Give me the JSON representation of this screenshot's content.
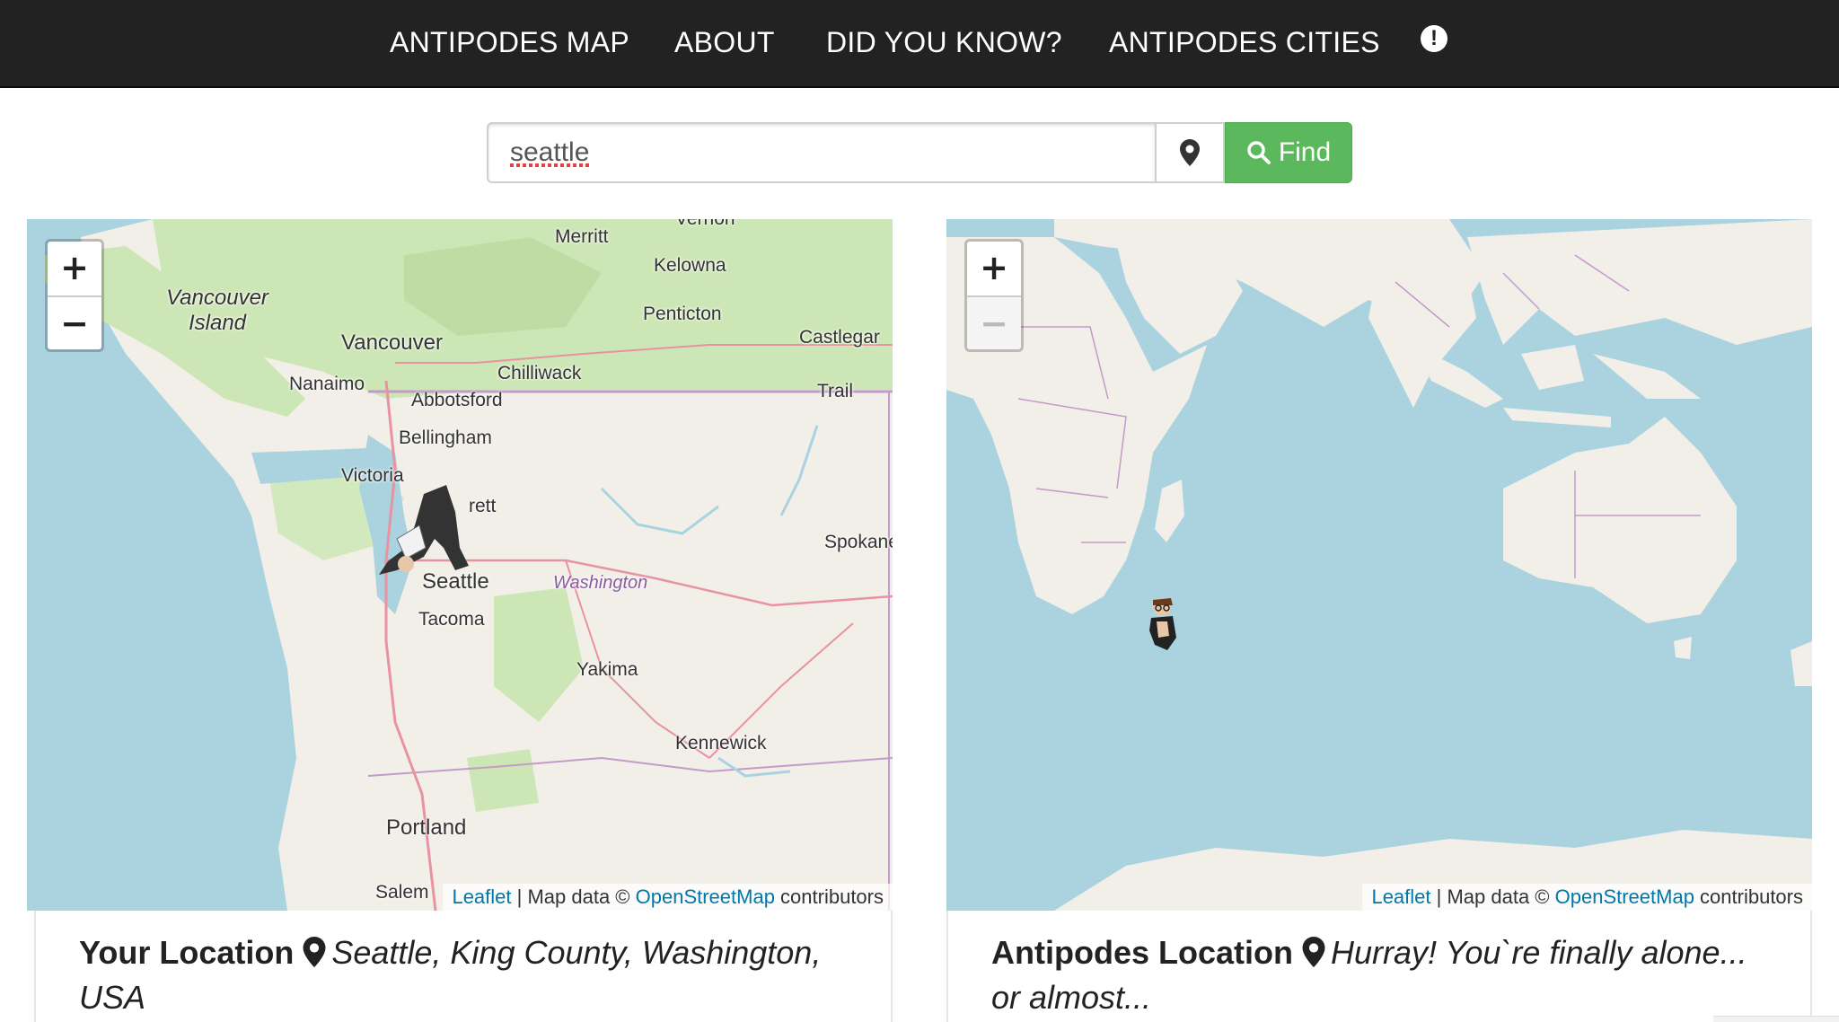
{
  "nav": {
    "items": [
      "ANTIPODES MAP",
      "ABOUT",
      "DID YOU KNOW?",
      "ANTIPODES CITIES"
    ],
    "info_icon": "exclamation-circle-icon"
  },
  "search": {
    "value": "seattle",
    "locate_icon": "map-marker-icon",
    "find_label": "Find",
    "find_icon": "search-icon",
    "find_color": "#5cb85c"
  },
  "left_map": {
    "labels": {
      "vernon": "Vernon",
      "merritt": "Merritt",
      "kelowna": "Kelowna",
      "penticton": "Penticton",
      "castlegar": "Castlegar",
      "trail": "Trail",
      "vancouver_island": "Vancouver Island",
      "vancouver": "Vancouver",
      "nanaimo": "Nanaimo",
      "chilliwack": "Chilliwack",
      "abbotsford": "Abbotsford",
      "bellingham": "Bellingham",
      "victoria": "Victoria",
      "everett": "rett",
      "spokane": "Spokane",
      "seattle": "Seattle",
      "washington": "Washington",
      "tacoma": "Tacoma",
      "yakima": "Yakima",
      "kennewick": "Kennewick",
      "portland": "Portland",
      "salem": "Salem"
    },
    "zoom_in": "+",
    "zoom_out": "−",
    "attribution": {
      "leaflet": "Leaflet",
      "middle": " | Map data © ",
      "osm": "OpenStreetMap",
      "end": " contributors"
    }
  },
  "right_map": {
    "zoom_in": "+",
    "zoom_out": "−",
    "zoom_out_disabled": true,
    "attribution": {
      "leaflet": "Leaflet",
      "middle": " | Map data © ",
      "osm": "OpenStreetMap",
      "end": " contributors"
    }
  },
  "your_location": {
    "title": "Your Location",
    "place": "Seattle, King County, Washington, USA"
  },
  "antipodes_location": {
    "title": "Antipodes Location",
    "place": "Hurray! You`re finally alone... or almost..."
  },
  "colors": {
    "navbar": "#222222",
    "water": "#aad3df",
    "land": "#f2efe9",
    "forest": "#cde6b5",
    "link": "#0078a8"
  }
}
